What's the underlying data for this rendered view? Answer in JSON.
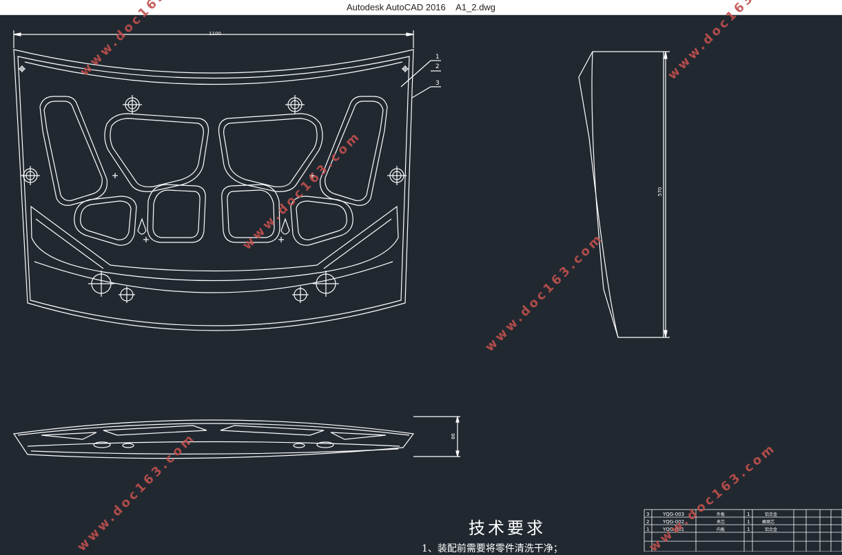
{
  "window": {
    "app_name": "Autodesk AutoCAD 2016",
    "file_name": "A1_2.dwg"
  },
  "drawing": {
    "dim_width": "1100",
    "dim_height_side": "570",
    "dim_thickness": "86",
    "callouts": [
      "1",
      "2",
      "3"
    ],
    "tech_title": "技术要求",
    "tech_line_1": "1、装配前需要将零件清洗干净；"
  },
  "bom": {
    "rows": [
      {
        "no": "3",
        "code": "YQG-003",
        "name": "外板",
        "qty": "1",
        "material": "铝合金"
      },
      {
        "no": "2",
        "code": "YQG-002",
        "name": "夹芯",
        "qty": "1",
        "material": "蜂窝芯"
      },
      {
        "no": "1",
        "code": "YQG-001",
        "name": "内板",
        "qty": "1",
        "material": "铝合金"
      }
    ]
  },
  "watermark_text": "www.doc163.com",
  "colors": {
    "background": "#212830",
    "line": "#ffffff",
    "watermark": "#c0504d"
  }
}
